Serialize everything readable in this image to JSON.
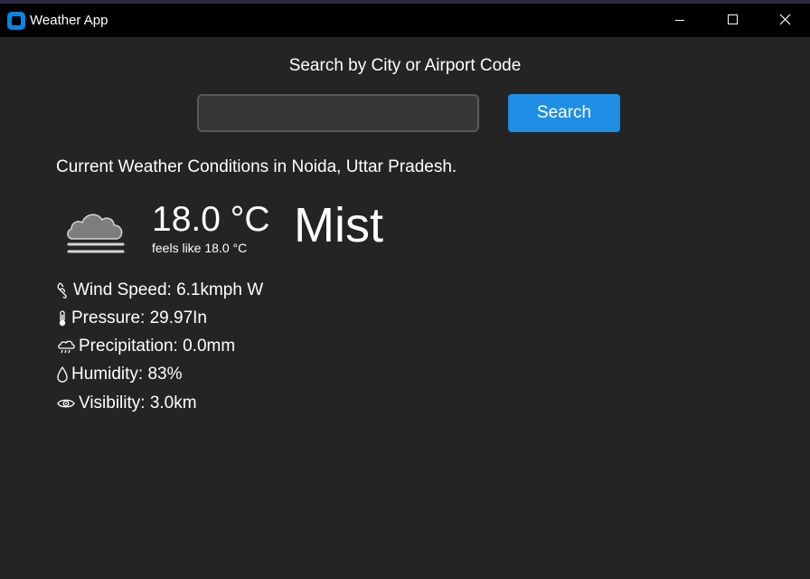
{
  "window": {
    "title": "Weather App",
    "icon": "app-icon",
    "controls": {
      "minimize": "minimize-icon",
      "maximize": "maximize-icon",
      "close": "close-icon"
    }
  },
  "search": {
    "title": "Search by City or Airport Code",
    "input_value": "",
    "placeholder": "",
    "button_label": "Search"
  },
  "current": {
    "heading": "Current Weather Conditions in Noida, Uttar Pradesh.",
    "icon": "cloud-fog-icon",
    "temperature": "18.0 °C",
    "feels_like": "feels like 18.0 °C",
    "condition": "Mist"
  },
  "details": {
    "wind": {
      "icon": "wind-icon",
      "label": "Wind Speed: 6.1kmph W"
    },
    "pressure": {
      "icon": "thermometer-icon",
      "label": "Pressure: 29.97In"
    },
    "precipitation": {
      "icon": "rain-cloud-icon",
      "label": "Precipitation: 0.0mm"
    },
    "humidity": {
      "icon": "droplet-icon",
      "label": "Humidity: 83%"
    },
    "visibility": {
      "icon": "eye-icon",
      "label": "Visibility: 3.0km"
    }
  },
  "colors": {
    "background": "#242424",
    "titlebar": "#000000",
    "accent": "#1f8fe5",
    "input_bg": "#343638",
    "input_border": "#565b5e"
  }
}
